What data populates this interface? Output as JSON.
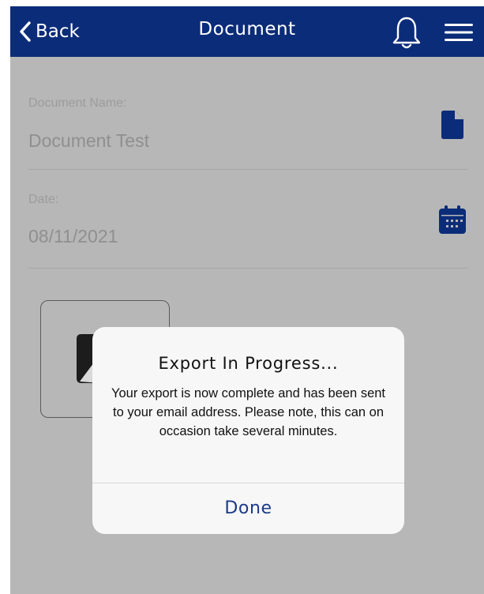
{
  "navbar": {
    "back_label": "Back",
    "title": "Document",
    "background_color": "#0b2c79",
    "icons": [
      "chevron-left-icon",
      "bell-icon",
      "hamburger-menu-icon"
    ]
  },
  "form": {
    "document_name": {
      "label": "Document Name:",
      "value": "Document Test",
      "icon": "document-icon"
    },
    "date": {
      "label": "Date:",
      "value": "08/11/2021",
      "icon": "calendar-icon"
    }
  },
  "dialog": {
    "title": "Export In Progress...",
    "message": "Your export is now complete and has been sent to your email address. Please note, this can on occasion take several minutes.",
    "button_label": "Done",
    "button_color": "#1b3a86"
  }
}
